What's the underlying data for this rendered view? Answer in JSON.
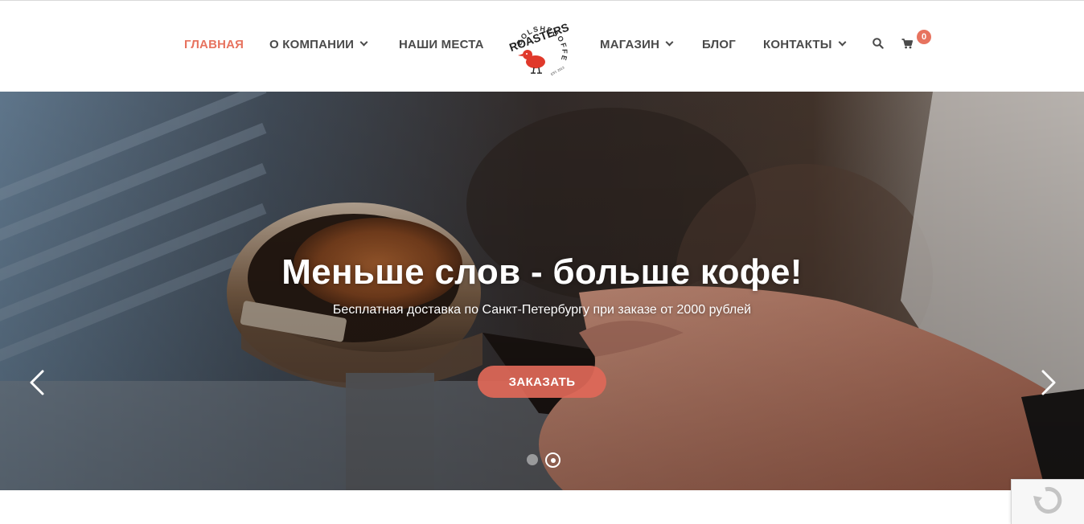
{
  "brand": {
    "logo_text": "ROASTERS",
    "logo_arc_text": "BOLSHECOFFEE",
    "logo_est": "EST. 2013",
    "accent_color": "#e7735f"
  },
  "nav": {
    "home": "ГЛАВНАЯ",
    "about": "О КОМПАНИИ",
    "places": "НАШИ МЕСТА",
    "shop": "МАГАЗИН",
    "blog": "БЛОГ",
    "contacts": "КОНТАКТЫ"
  },
  "cart": {
    "count": "0"
  },
  "hero": {
    "title": "Меньше слов - больше кофе!",
    "subtitle": "Бесплатная доставка по Санкт-Петербургу при заказе от 2000 рублей",
    "cta": "ЗАКАЗАТЬ",
    "slides_total": 2,
    "active_slide": 2
  }
}
